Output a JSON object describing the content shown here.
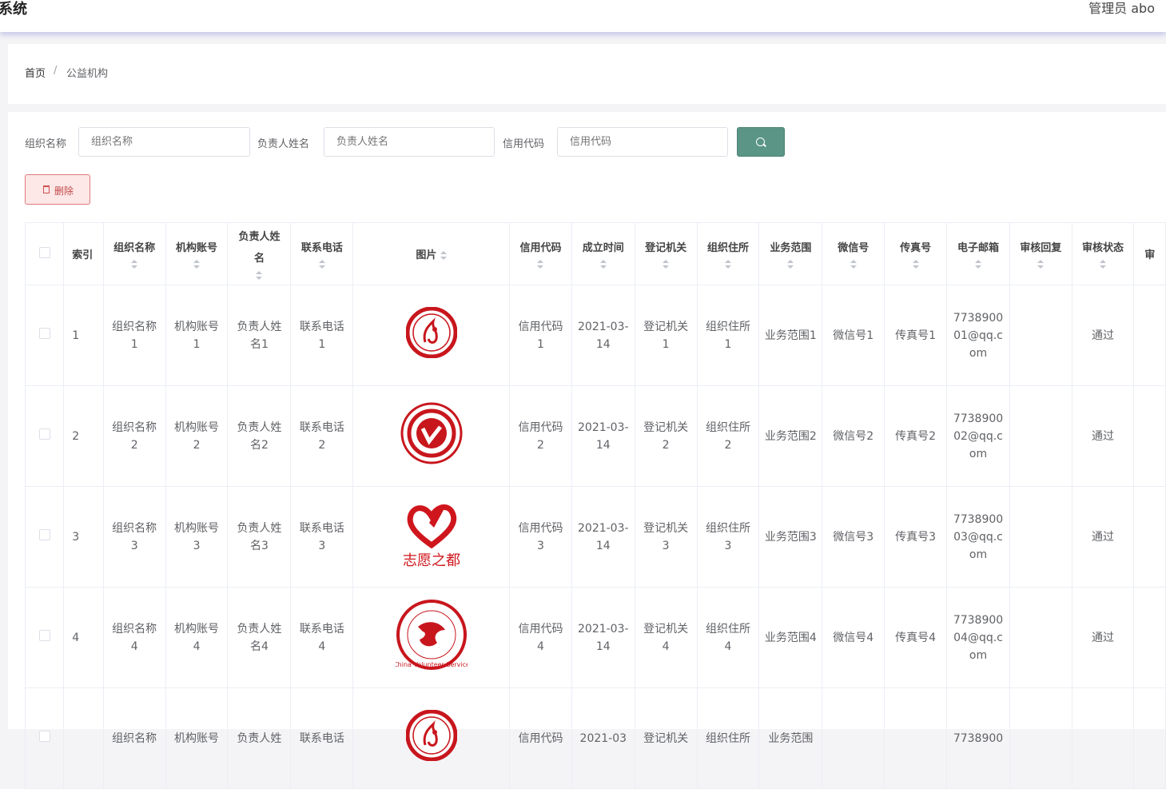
{
  "header": {
    "title": "系统",
    "user": "管理员 abo"
  },
  "breadcrumb": {
    "home": "首页",
    "separator": "/",
    "current": "公益机构"
  },
  "search": {
    "fields": [
      {
        "label": "组织名称",
        "placeholder": "组织名称"
      },
      {
        "label": "负责人姓名",
        "placeholder": "负责人姓名"
      },
      {
        "label": "信用代码",
        "placeholder": "信用代码"
      }
    ],
    "button_icon": "search-icon"
  },
  "toolbar": {
    "delete_label": "删除",
    "delete_icon": "trash-icon"
  },
  "table": {
    "columns": [
      "索引",
      "组织名称",
      "机构账号",
      "负责人姓名",
      "联系电话",
      "图片",
      "信用代码",
      "成立时间",
      "登记机关",
      "组织住所",
      "业务范围",
      "微信号",
      "传真号",
      "电子邮箱",
      "审核回复",
      "审核状态",
      "审"
    ],
    "rows": [
      {
        "index": "1",
        "org_name": "组织名称1",
        "account": "机构账号1",
        "leader": "负责人姓名1",
        "phone": "联系电话1",
        "image": "volunteer-logo-1",
        "credit": "信用代码1",
        "founded": "2021-03-14",
        "authority": "登记机关1",
        "address": "组织住所1",
        "scope": "业务范围1",
        "wechat": "微信号1",
        "fax": "传真号1",
        "email": "773890001@qq.com",
        "reply": "",
        "status": "通过"
      },
      {
        "index": "2",
        "org_name": "组织名称2",
        "account": "机构账号2",
        "leader": "负责人姓名2",
        "phone": "联系电话2",
        "image": "volunteer-logo-2",
        "credit": "信用代码2",
        "founded": "2021-03-14",
        "authority": "登记机关2",
        "address": "组织住所2",
        "scope": "业务范围2",
        "wechat": "微信号2",
        "fax": "传真号2",
        "email": "773890002@qq.com",
        "reply": "",
        "status": "通过"
      },
      {
        "index": "3",
        "org_name": "组织名称3",
        "account": "机构账号3",
        "leader": "负责人姓名3",
        "phone": "联系电话3",
        "image": "volunteer-logo-3",
        "image_text": "志愿之都",
        "credit": "信用代码3",
        "founded": "2021-03-14",
        "authority": "登记机关3",
        "address": "组织住所3",
        "scope": "业务范围3",
        "wechat": "微信号3",
        "fax": "传真号3",
        "email": "773890003@qq.com",
        "reply": "",
        "status": "通过"
      },
      {
        "index": "4",
        "org_name": "组织名称4",
        "account": "机构账号4",
        "leader": "负责人姓名4",
        "phone": "联系电话4",
        "image": "volunteer-logo-4",
        "image_text": "China Volunteer Service",
        "credit": "信用代码4",
        "founded": "2021-03-14",
        "authority": "登记机关4",
        "address": "组织住所4",
        "scope": "业务范围4",
        "wechat": "微信号4",
        "fax": "传真号4",
        "email": "773890004@qq.com",
        "reply": "",
        "status": "通过"
      },
      {
        "index": "",
        "org_name": "组织名称",
        "account": "机构账号",
        "leader": "负责人姓",
        "phone": "联系电话",
        "image": "volunteer-logo-1",
        "credit": "信用代码",
        "founded": "2021-03",
        "authority": "登记机关",
        "address": "组织住所",
        "scope": "业务范围",
        "wechat": "",
        "fax": "",
        "email": "7738900",
        "reply": "",
        "status": ""
      }
    ]
  },
  "colors": {
    "search_button": "#5a9586",
    "delete_bg": "#fde7e7",
    "delete_text": "#f56c6c",
    "logo_red": "#c8161d"
  }
}
